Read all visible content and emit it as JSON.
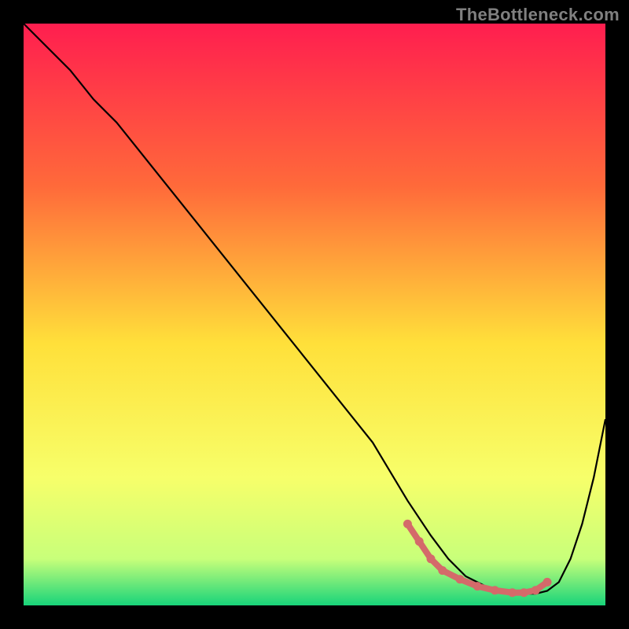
{
  "watermark": "TheBottleneck.com",
  "chart_data": {
    "type": "line",
    "title": "",
    "xlabel": "",
    "ylabel": "",
    "xlim": [
      0,
      100
    ],
    "ylim": [
      0,
      100
    ],
    "grid": false,
    "series": [
      {
        "name": "bottleneck-curve",
        "x": [
          0,
          4,
          8,
          12,
          16,
          20,
          24,
          28,
          32,
          36,
          40,
          44,
          48,
          52,
          56,
          60,
          63,
          66,
          70,
          73,
          76,
          80,
          84,
          88,
          90,
          92,
          94,
          96,
          98,
          100
        ],
        "y": [
          100,
          96,
          92,
          87,
          83,
          78,
          73,
          68,
          63,
          58,
          53,
          48,
          43,
          38,
          33,
          28,
          23,
          18,
          12,
          8,
          5,
          3,
          2,
          2,
          2.5,
          4,
          8,
          14,
          22,
          32
        ]
      }
    ],
    "highlight": {
      "name": "optimal-range",
      "x": [
        66,
        68,
        70,
        72,
        75,
        78,
        81,
        84,
        86,
        88,
        90
      ],
      "y": [
        14,
        11,
        8,
        6,
        4.5,
        3.3,
        2.6,
        2.2,
        2.2,
        2.6,
        4
      ]
    },
    "background_gradient": {
      "top": "#ff1e4f",
      "mid_upper": "#ff8a3a",
      "mid": "#ffe03a",
      "mid_lower": "#f7ff6a",
      "bottom": "#18d47a"
    }
  }
}
